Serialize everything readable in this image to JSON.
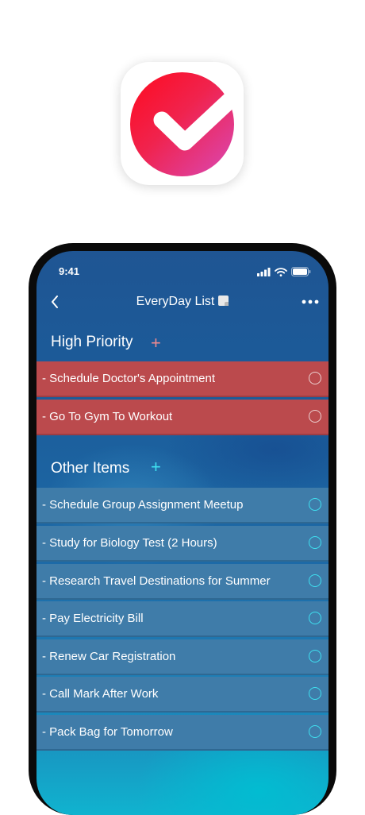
{
  "colors": {
    "high_priority_row": "#bb4a4d",
    "other_row": "#3f7ca9",
    "high_add_icon": "#f08a8f",
    "other_add_icon": "#3fe0f0",
    "icon_gradient_start": "#ff0a1e",
    "icon_gradient_end": "#d949b6"
  },
  "status_bar": {
    "time": "9:41"
  },
  "nav": {
    "title": "EveryDay List",
    "back_icon": "chevron-left-icon",
    "more_icon": "ellipsis-icon"
  },
  "high_priority": {
    "title": "High Priority",
    "add_icon": "plus-icon",
    "items": [
      {
        "label": "- Schedule Doctor's Appointment"
      },
      {
        "label": "- Go To Gym To Workout"
      }
    ]
  },
  "other_items": {
    "title": "Other Items",
    "add_icon": "plus-icon",
    "items": [
      {
        "label": "- Schedule Group Assignment Meetup"
      },
      {
        "label": "- Study for Biology Test (2 Hours)"
      },
      {
        "label": "- Research Travel Destinations for Summer"
      },
      {
        "label": "- Pay Electricity Bill"
      },
      {
        "label": "- Renew Car Registration"
      },
      {
        "label": "- Call Mark After Work"
      },
      {
        "label": "- Pack Bag for Tomorrow"
      }
    ]
  }
}
